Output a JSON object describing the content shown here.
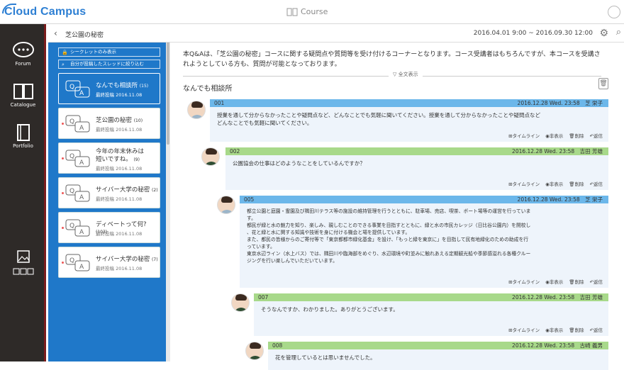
{
  "app": {
    "logo": "Cloud Campus",
    "center_label": "Course"
  },
  "nav": [
    {
      "label": "Forum",
      "icon": "forum-icon"
    },
    {
      "label": "Catalogue",
      "icon": "book-icon"
    },
    {
      "label": "Portfolio",
      "icon": "portfolio-icon"
    }
  ],
  "header": {
    "title": "芝公園の秘密",
    "period": "2016.04.01 9:00 ~ 2016.09.30 12:00"
  },
  "filters": [
    "シークレットのみ表示",
    "自分が投稿したスレッドに絞り込む"
  ],
  "threads": [
    {
      "title": "なんでも相談所",
      "count": "(15)",
      "sub": "最終投稿 2016.11.08",
      "active": true
    },
    {
      "title": "芝公園の秘密",
      "count": "(10)",
      "sub": "最終投稿 2016.11.08"
    },
    {
      "title": "今年の年末休みは",
      "title2": "短いですね。",
      "count": "(9)",
      "sub": "最終投稿 2016.11.08"
    },
    {
      "title": "サイバー大学の秘密",
      "count": "(2)",
      "sub": "最終投稿 2016.11.08"
    },
    {
      "title": "ディベートって何?",
      "count": "(103)",
      "sub": "最終投稿 2016.11.08"
    },
    {
      "title": "サイバー大学の秘密",
      "count": "(7)",
      "sub": "最終投稿 2016.11.08"
    }
  ],
  "main": {
    "intro": "本Q&Aは、「芝公園の秘密」コースに関する疑問点や質問等を受け付けるコーナーとなります。コース受講者はもちろんですが、本コースを受講されようとしている方も、質問が可能となっております。",
    "expand_label": "▽ 全文表示",
    "section_title": "なんでも相談所"
  },
  "actions": {
    "timeline": "タイムライン",
    "hide": "非表示",
    "delete": "削除",
    "reply": "返信"
  },
  "posts": [
    {
      "id": "001",
      "date": "2016.12.28 Wed. 23:58",
      "author": "芝 栄子",
      "color": "blue",
      "body": [
        "授業を通して分からなかったことや疑問点など、どんなことでも気軽に聞いてください。授業を通して分からなかったことや疑問点など",
        "どんなことでも気軽に聞いてください。"
      ]
    },
    {
      "id": "002",
      "date": "2016.12.28 Wed. 23:58",
      "author": "吉田 芳雄",
      "color": "green",
      "body": [
        "公園協会の仕事はどのようなことをしているんですか？"
      ]
    },
    {
      "id": "005",
      "date": "2016.12.28 Wed. 23:58",
      "author": "芝 栄子",
      "color": "blue",
      "body": [
        "都立公園と庭園・霊園及び隅田川テラス等の施設の維持管理を行うとともに、駐車場、売店、喫茶、ボート場等の運営を行っていま",
        "す。",
        "都民が緑と水の魅力を知り、楽しみ、親しむことのできる事業を目指すとともに、緑と水の市民カレッジ（日比谷公園内）を開校し",
        "、花と緑と水に関する知識や技術を身に付ける機会と場を提供しています。",
        "また、都民の皆様からのご寄付等で「東京都都市緑化基金」を設け、「もっと緑を東京に」を目指して民有地緑化のための助成を行",
        "っています。",
        "東京水辺ライン（水上バス）では、隅田川や臨海部をめぐり、水辺環境や町並みに触れあえる定期観光船や季節感溢れる各種クルー",
        "ジングを行い楽しんでいただいています。"
      ]
    },
    {
      "id": "007",
      "date": "2016.12.28 Wed. 23:58",
      "author": "吉田 芳雄",
      "color": "green",
      "body": [
        "そうなんですか、わかりました。ありがとうございます。"
      ]
    },
    {
      "id": "008",
      "date": "2016.12.28 Wed. 23:58",
      "author": "古崎 義男",
      "color": "green",
      "body": [
        "花を管理しているとは思いませんでした。"
      ]
    }
  ]
}
